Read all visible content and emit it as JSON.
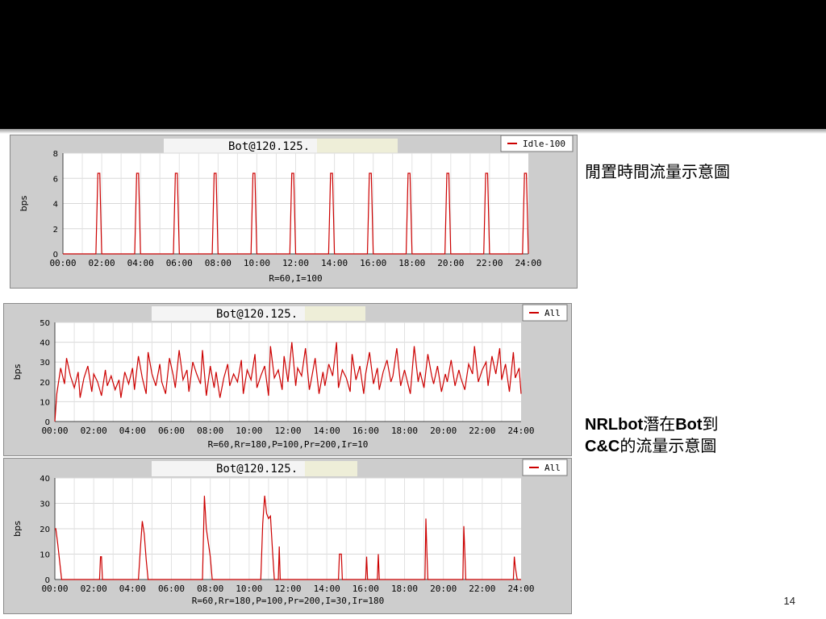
{
  "slide": {
    "caption_idle": "閒置時間流量示意圖",
    "caption_nrl": {
      "part1": "NRLbot",
      "part2": "潛在",
      "part3": "Bot",
      "part4": "到",
      "part5": "C&C",
      "part6": "的流量示意圖"
    },
    "page_number": "14"
  },
  "chart_data": [
    {
      "type": "line",
      "title": "Bot@120.125.",
      "subtitle": "R=60,I=100",
      "ylabel": "bps",
      "ylim": [
        0,
        8
      ],
      "yticks": [
        "0",
        "2",
        "4",
        "6",
        "8"
      ],
      "xticks": [
        "00:00",
        "02:00",
        "04:00",
        "06:00",
        "08:00",
        "10:00",
        "12:00",
        "14:00",
        "16:00",
        "18:00",
        "20:00",
        "22:00",
        "24:00"
      ],
      "series": [
        {
          "name": "Idle-100",
          "color": "#cc0000",
          "x": [
            0,
            1.7,
            1.8,
            1.9,
            2.0,
            3.7,
            3.8,
            3.9,
            4.0,
            5.7,
            5.8,
            5.9,
            6.0,
            7.7,
            7.8,
            7.9,
            8.0,
            9.7,
            9.8,
            9.9,
            10.0,
            11.7,
            11.8,
            11.9,
            12.0,
            13.7,
            13.8,
            13.9,
            14.0,
            15.7,
            15.8,
            15.9,
            16.0,
            17.7,
            17.8,
            17.9,
            18.0,
            19.7,
            19.8,
            19.9,
            20.0,
            21.7,
            21.8,
            21.9,
            22.0,
            23.7,
            23.8,
            23.9,
            24.0
          ],
          "values": [
            0,
            0,
            6.4,
            6.4,
            0,
            0,
            6.4,
            6.4,
            0,
            0,
            6.4,
            6.4,
            0,
            0,
            6.4,
            6.4,
            0,
            0,
            6.4,
            6.4,
            0,
            0,
            6.4,
            6.4,
            0,
            0,
            6.4,
            6.4,
            0,
            0,
            6.4,
            6.4,
            0,
            0,
            6.4,
            6.4,
            0,
            0,
            6.4,
            6.4,
            0,
            0,
            6.4,
            6.4,
            0,
            0,
            6.4,
            6.4,
            0
          ]
        }
      ]
    },
    {
      "type": "line",
      "title": "Bot@120.125.",
      "subtitle": "R=60,Rr=180,P=100,Pr=200,Ir=10",
      "ylabel": "bps",
      "ylim": [
        0,
        50
      ],
      "yticks": [
        "0",
        "10",
        "20",
        "30",
        "40",
        "50"
      ],
      "xticks": [
        "00:00",
        "02:00",
        "04:00",
        "06:00",
        "08:00",
        "10:00",
        "12:00",
        "14:00",
        "16:00",
        "18:00",
        "20:00",
        "22:00",
        "24:00"
      ],
      "series": [
        {
          "name": "All",
          "color": "#cc0000",
          "x": [
            0,
            0.1,
            0.3,
            0.5,
            0.6,
            0.8,
            1.0,
            1.2,
            1.3,
            1.5,
            1.7,
            1.9,
            2.0,
            2.2,
            2.4,
            2.6,
            2.7,
            2.9,
            3.1,
            3.3,
            3.4,
            3.6,
            3.8,
            4.0,
            4.1,
            4.3,
            4.5,
            4.7,
            4.8,
            5.0,
            5.2,
            5.4,
            5.5,
            5.7,
            5.9,
            6.1,
            6.2,
            6.4,
            6.6,
            6.8,
            6.9,
            7.1,
            7.3,
            7.5,
            7.6,
            7.8,
            8.0,
            8.2,
            8.3,
            8.5,
            8.7,
            8.9,
            9.0,
            9.2,
            9.4,
            9.6,
            9.7,
            9.9,
            10.1,
            10.3,
            10.4,
            10.6,
            10.8,
            11.0,
            11.1,
            11.3,
            11.5,
            11.7,
            11.8,
            12.0,
            12.2,
            12.4,
            12.5,
            12.7,
            12.9,
            13.1,
            13.2,
            13.4,
            13.6,
            13.8,
            13.9,
            14.1,
            14.3,
            14.5,
            14.6,
            14.8,
            15.0,
            15.2,
            15.3,
            15.5,
            15.7,
            15.9,
            16.0,
            16.2,
            16.4,
            16.6,
            16.7,
            16.9,
            17.1,
            17.3,
            17.4,
            17.6,
            17.8,
            18.0,
            18.1,
            18.3,
            18.5,
            18.7,
            18.8,
            19.0,
            19.2,
            19.4,
            19.5,
            19.7,
            19.9,
            20.1,
            20.2,
            20.4,
            20.6,
            20.8,
            20.9,
            21.1,
            21.3,
            21.5,
            21.6,
            21.8,
            22.0,
            22.2,
            22.3,
            22.5,
            22.7,
            22.9,
            23.0,
            23.2,
            23.4,
            23.6,
            23.7,
            23.9,
            24.0
          ],
          "values": [
            0,
            14,
            27,
            19,
            32,
            23,
            17,
            25,
            12,
            22,
            28,
            15,
            24,
            20,
            13,
            26,
            18,
            23,
            16,
            21,
            12,
            25,
            19,
            27,
            16,
            33,
            22,
            14,
            35,
            24,
            18,
            29,
            20,
            14,
            32,
            23,
            17,
            36,
            21,
            26,
            15,
            30,
            24,
            19,
            36,
            13,
            28,
            17,
            25,
            12,
            22,
            29,
            18,
            24,
            20,
            31,
            14,
            26,
            21,
            34,
            17,
            23,
            28,
            13,
            38,
            22,
            26,
            16,
            33,
            20,
            40,
            18,
            27,
            23,
            37,
            16,
            21,
            32,
            14,
            25,
            18,
            29,
            23,
            40,
            17,
            26,
            22,
            15,
            34,
            21,
            28,
            14,
            24,
            35,
            19,
            27,
            16,
            25,
            31,
            20,
            23,
            37,
            18,
            26,
            22,
            14,
            38,
            20,
            25,
            17,
            34,
            23,
            19,
            28,
            15,
            24,
            20,
            31,
            18,
            26,
            22,
            16,
            29,
            24,
            38,
            20,
            26,
            30,
            18,
            33,
            24,
            37,
            21,
            29,
            15,
            35,
            22,
            27,
            14
          ]
        }
      ]
    },
    {
      "type": "line",
      "title": "Bot@120.125.",
      "subtitle": "R=60,Rr=180,P=100,Pr=200,I=30,Ir=180",
      "ylabel": "bps",
      "ylim": [
        0,
        40
      ],
      "yticks": [
        "0",
        "10",
        "20",
        "30",
        "40"
      ],
      "xticks": [
        "00:00",
        "02:00",
        "04:00",
        "06:00",
        "08:00",
        "10:00",
        "12:00",
        "14:00",
        "16:00",
        "18:00",
        "20:00",
        "22:00",
        "24:00"
      ],
      "series": [
        {
          "name": "All",
          "color": "#cc0000",
          "x": [
            0,
            0.05,
            0.15,
            0.25,
            0.35,
            2.3,
            2.35,
            2.4,
            2.45,
            4.3,
            4.4,
            4.5,
            4.6,
            4.7,
            4.8,
            7.6,
            7.7,
            7.8,
            8.0,
            8.1,
            10.6,
            10.7,
            10.8,
            10.9,
            11.0,
            11.1,
            11.2,
            11.3,
            11.5,
            11.55,
            11.6,
            14.6,
            14.65,
            14.75,
            14.8,
            16.0,
            16.05,
            16.1,
            16.6,
            16.65,
            16.7,
            19.05,
            19.1,
            19.15,
            19.2,
            21.0,
            21.05,
            21.1,
            21.15,
            23.6,
            23.65,
            23.7,
            23.8,
            24.0
          ],
          "values": [
            20,
            20,
            14,
            7,
            0,
            0,
            9,
            9,
            0,
            0,
            12,
            23,
            18,
            8,
            0,
            0,
            33,
            20,
            9,
            0,
            0,
            22,
            33,
            26,
            24,
            25,
            12,
            0,
            0,
            13,
            0,
            0,
            10,
            10,
            0,
            0,
            9,
            0,
            0,
            10,
            0,
            0,
            24,
            11,
            0,
            0,
            21,
            11,
            0,
            0,
            9,
            5,
            0,
            0
          ]
        }
      ]
    }
  ]
}
